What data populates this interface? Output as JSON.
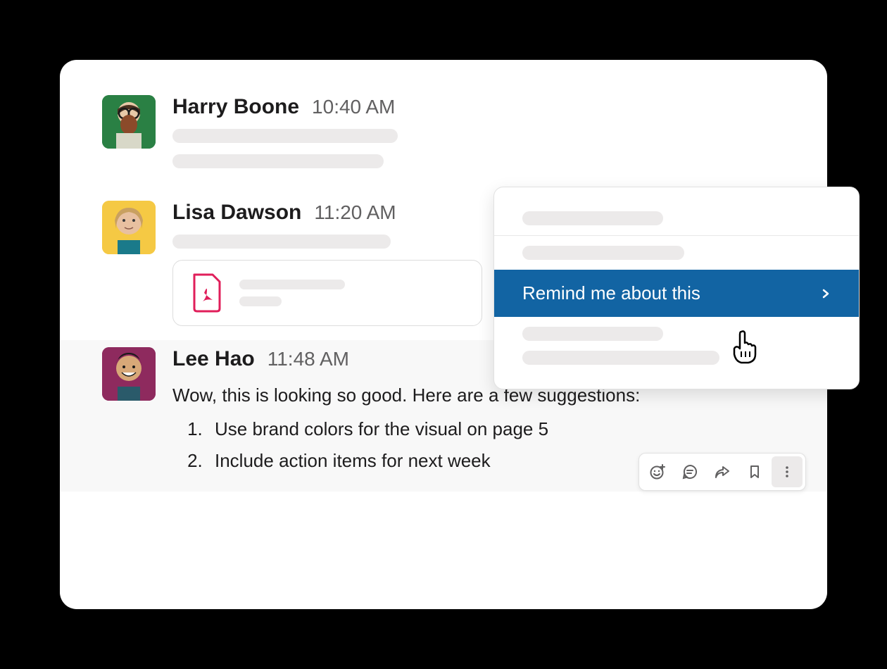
{
  "messages": [
    {
      "author": "Harry Boone",
      "timestamp": "10:40 AM",
      "avatar_bg": "#2a8044"
    },
    {
      "author": "Lisa Dawson",
      "timestamp": "11:20 AM",
      "avatar_bg": "#f5c944"
    },
    {
      "author": "Lee Hao",
      "timestamp": "11:48 AM",
      "avatar_bg": "#8e2a5e",
      "body_intro": "Wow, this is looking so good. Here are a few suggestions:",
      "body_items": [
        "Use brand colors for the visual on page 5",
        "Include action items for next week"
      ]
    }
  ],
  "context_menu": {
    "active_label": "Remind me about this"
  },
  "toolbar_icons": [
    "add-reaction",
    "thread",
    "share",
    "bookmark",
    "more"
  ]
}
